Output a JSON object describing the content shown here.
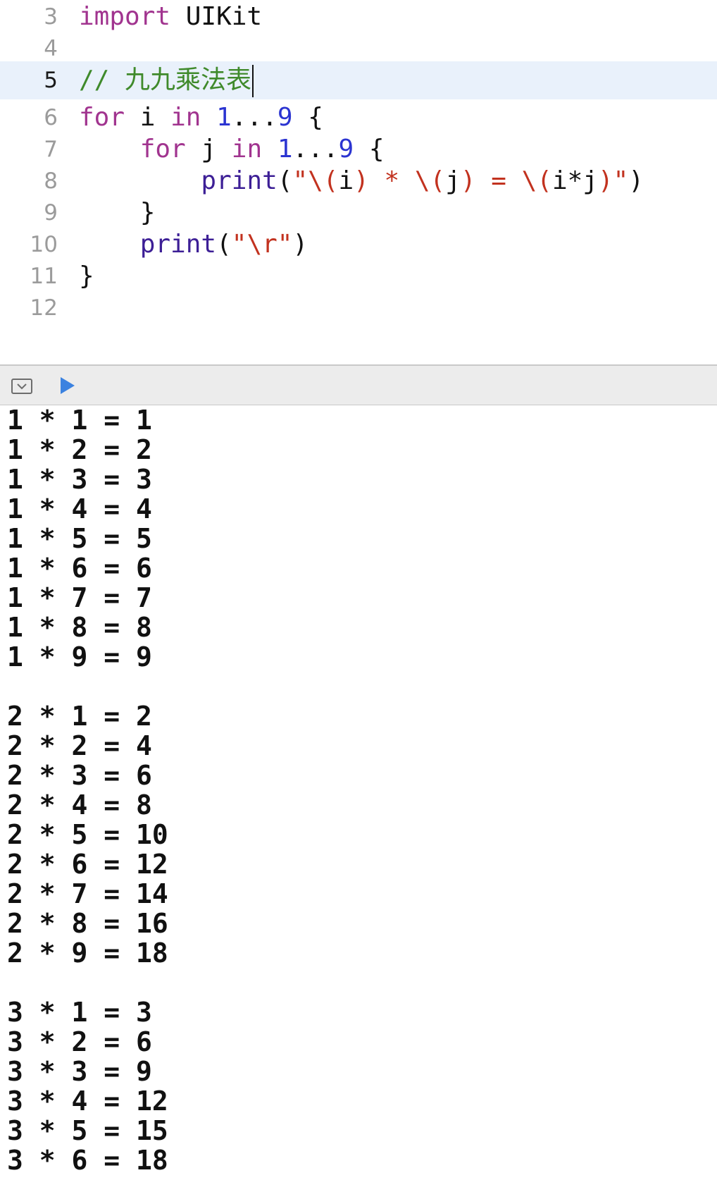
{
  "editor": {
    "lines": [
      {
        "no": "3",
        "current": false,
        "tokens": [
          {
            "t": "import",
            "c": "kw"
          },
          {
            "t": " UIKit",
            "c": ""
          }
        ]
      },
      {
        "no": "4",
        "current": false,
        "tokens": []
      },
      {
        "no": "5",
        "current": true,
        "tokens": [
          {
            "t": "// 九九乘法表",
            "c": "cmt"
          }
        ]
      },
      {
        "no": "6",
        "current": false,
        "tokens": [
          {
            "t": "for",
            "c": "kw"
          },
          {
            "t": " i ",
            "c": ""
          },
          {
            "t": "in",
            "c": "kw"
          },
          {
            "t": " ",
            "c": ""
          },
          {
            "t": "1",
            "c": "num"
          },
          {
            "t": "...",
            "c": ""
          },
          {
            "t": "9",
            "c": "num"
          },
          {
            "t": " {",
            "c": ""
          }
        ]
      },
      {
        "no": "7",
        "current": false,
        "tokens": [
          {
            "t": "    ",
            "c": ""
          },
          {
            "t": "for",
            "c": "kw"
          },
          {
            "t": " j ",
            "c": ""
          },
          {
            "t": "in",
            "c": "kw"
          },
          {
            "t": " ",
            "c": ""
          },
          {
            "t": "1",
            "c": "num"
          },
          {
            "t": "...",
            "c": ""
          },
          {
            "t": "9",
            "c": "num"
          },
          {
            "t": " {",
            "c": ""
          }
        ]
      },
      {
        "no": "8",
        "current": false,
        "tokens": [
          {
            "t": "        ",
            "c": ""
          },
          {
            "t": "print",
            "c": "fn"
          },
          {
            "t": "(",
            "c": ""
          },
          {
            "t": "\"\\(",
            "c": "str"
          },
          {
            "t": "i",
            "c": ""
          },
          {
            "t": ") * \\(",
            "c": "str"
          },
          {
            "t": "j",
            "c": ""
          },
          {
            "t": ") = \\(",
            "c": "str"
          },
          {
            "t": "i*j",
            "c": ""
          },
          {
            "t": ")\"",
            "c": "str"
          },
          {
            "t": ")",
            "c": ""
          }
        ]
      },
      {
        "no": "9",
        "current": false,
        "tokens": [
          {
            "t": "    }",
            "c": ""
          }
        ]
      },
      {
        "no": "10",
        "current": false,
        "tokens": [
          {
            "t": "    ",
            "c": ""
          },
          {
            "t": "print",
            "c": "fn"
          },
          {
            "t": "(",
            "c": ""
          },
          {
            "t": "\"\\r\"",
            "c": "str"
          },
          {
            "t": ")",
            "c": ""
          }
        ]
      },
      {
        "no": "11",
        "current": false,
        "tokens": [
          {
            "t": "}",
            "c": ""
          }
        ]
      },
      {
        "no": "12",
        "current": false,
        "tokens": []
      }
    ]
  },
  "console": {
    "output": [
      "1 * 1 = 1",
      "1 * 2 = 2",
      "1 * 3 = 3",
      "1 * 4 = 4",
      "1 * 5 = 5",
      "1 * 6 = 6",
      "1 * 7 = 7",
      "1 * 8 = 8",
      "1 * 9 = 9",
      "",
      "2 * 1 = 2",
      "2 * 2 = 4",
      "2 * 3 = 6",
      "2 * 4 = 8",
      "2 * 5 = 10",
      "2 * 6 = 12",
      "2 * 7 = 14",
      "2 * 8 = 16",
      "2 * 9 = 18",
      "",
      "3 * 1 = 3",
      "3 * 2 = 6",
      "3 * 3 = 9",
      "3 * 4 = 12",
      "3 * 5 = 15",
      "3 * 6 = 18"
    ]
  },
  "toolbar": {
    "hide_icon": "hide-debug-area-icon",
    "run_icon": "play-icon",
    "run_color": "#3b82e0"
  }
}
